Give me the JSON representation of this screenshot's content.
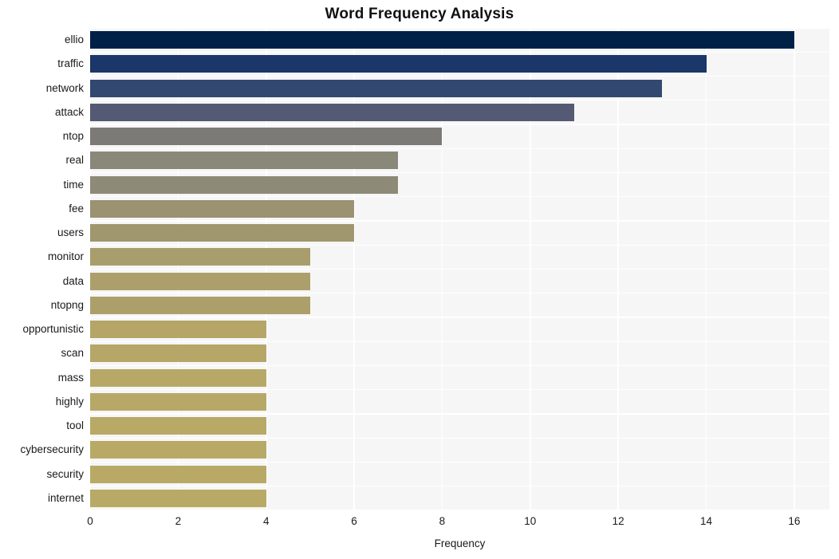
{
  "chart_data": {
    "type": "bar",
    "orientation": "horizontal",
    "title": "Word Frequency Analysis",
    "xlabel": "Frequency",
    "ylabel": "",
    "xlim": [
      0,
      16.8
    ],
    "ylim": [
      0,
      20
    ],
    "grid": true,
    "legend": null,
    "xticks": [
      0,
      2,
      4,
      6,
      8,
      10,
      12,
      14,
      16
    ],
    "xtick_labels": [
      "0",
      "2",
      "4",
      "6",
      "8",
      "10",
      "12",
      "14",
      "16"
    ],
    "categories": [
      "ellio",
      "traffic",
      "network",
      "attack",
      "ntop",
      "real",
      "time",
      "fee",
      "users",
      "monitor",
      "data",
      "ntopng",
      "opportunistic",
      "scan",
      "mass",
      "highly",
      "tool",
      "cybersecurity",
      "security",
      "internet"
    ],
    "values": [
      16,
      14,
      13,
      11,
      8,
      7,
      7,
      6,
      6,
      5,
      5,
      5,
      4,
      4,
      4,
      4,
      4,
      4,
      4,
      4
    ],
    "bar_colors": [
      "#002147",
      "#1b3668",
      "#334870",
      "#545a73",
      "#7b7a76",
      "#8a8879",
      "#8d8a78",
      "#9a9271",
      "#a0976f",
      "#a89d6c",
      "#ac9f6b",
      "#ad9f6a",
      "#b5a668",
      "#b6a768",
      "#b7a867",
      "#b7a867",
      "#b8a967",
      "#b8a967",
      "#b8a967",
      "#b8a967"
    ],
    "plot_background": "#f6f6f6",
    "grid_color": "#ffffff",
    "figure_background": "#ffffff"
  }
}
